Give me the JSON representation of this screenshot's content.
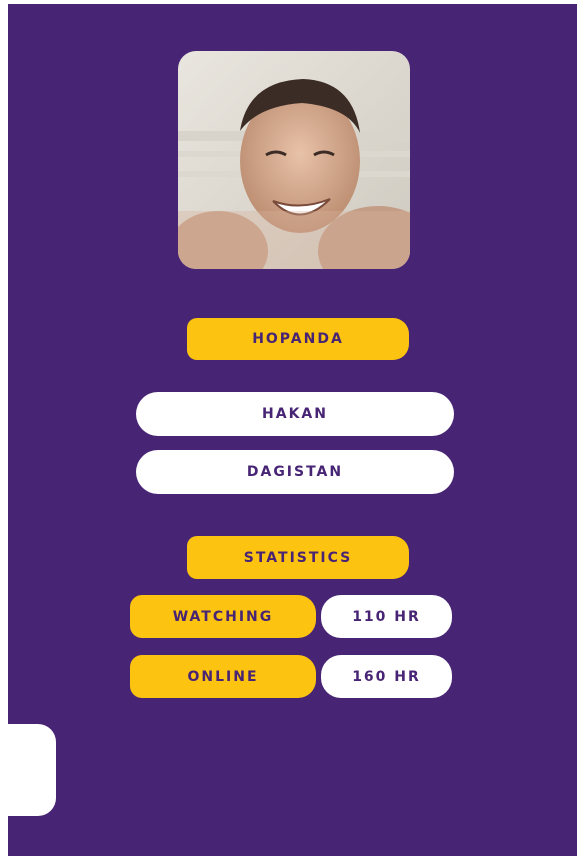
{
  "profile": {
    "photo_icon": "user-photo",
    "username": "HOPANDA",
    "first_name": "HAKAN",
    "last_name": "DAGISTAN"
  },
  "statistics": {
    "title": "STATISTICS",
    "rows": [
      {
        "label": "WATCHING",
        "value": "110 HR"
      },
      {
        "label": "ONLINE",
        "value": "160 HR"
      }
    ]
  },
  "colors": {
    "background": "#472474",
    "accent": "#fcc310",
    "panel": "#ffffff",
    "text": "#472474"
  }
}
